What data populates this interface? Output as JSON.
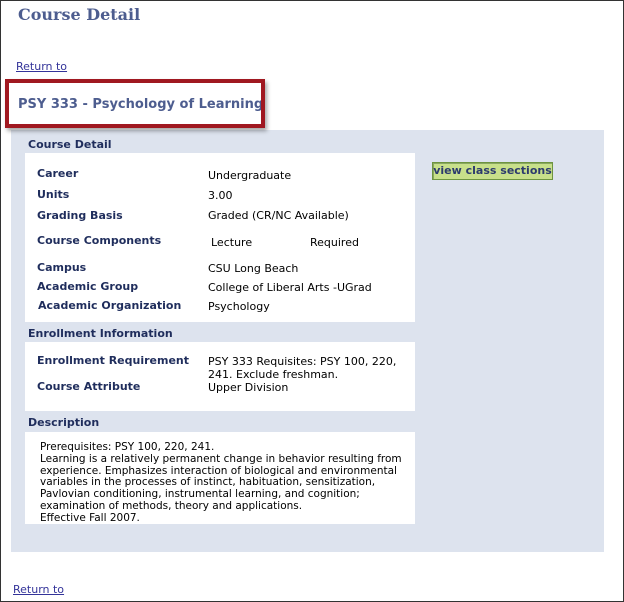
{
  "page": {
    "title": "Course Detail",
    "return_link": "Return to"
  },
  "course": {
    "heading": "PSY  333 - Psychology of Learning"
  },
  "course_detail": {
    "section_title": "Course Detail",
    "view_button": "view class sections",
    "career": {
      "label": "Career",
      "value": "Undergraduate"
    },
    "units": {
      "label": "Units",
      "value": "3.00"
    },
    "grading": {
      "label": "Grading Basis",
      "value": "Graded (CR/NC Available)"
    },
    "components": {
      "label": "Course Components",
      "value": "Lecture",
      "status": "Required"
    },
    "campus": {
      "label": "Campus",
      "value": "CSU Long Beach"
    },
    "academic_group": {
      "label": "Academic Group",
      "value": "College of Liberal Arts -UGrad"
    },
    "academic_org": {
      "label": "Academic Organization",
      "value": "Psychology"
    }
  },
  "enrollment": {
    "section_title": "Enrollment Information",
    "requirement": {
      "label": "Enrollment Requirement",
      "value_line1": "PSY 333 Requisites: PSY 100, 220,",
      "value_line2": "241. Exclude freshman."
    },
    "attribute": {
      "label": "Course Attribute",
      "value": "Upper Division"
    }
  },
  "description": {
    "section_title": "Description",
    "text": "Prerequisites: PSY 100, 220, 241.\nLearning is a relatively permanent change in behavior resulting from experience. Emphasizes interaction of biological and environmental variables in the processes of instinct, habituation, sensitization, Pavlovian conditioning, instrumental learning, and cognition; examination of methods, theory and applications.\nEffective Fall 2007."
  },
  "colors": {
    "panel_bg": "#dde3ee",
    "title_color": "#4d5d8f",
    "label_color": "#1f2d5c",
    "highlight": "#a01820",
    "button_bg": "#c8e08a"
  }
}
